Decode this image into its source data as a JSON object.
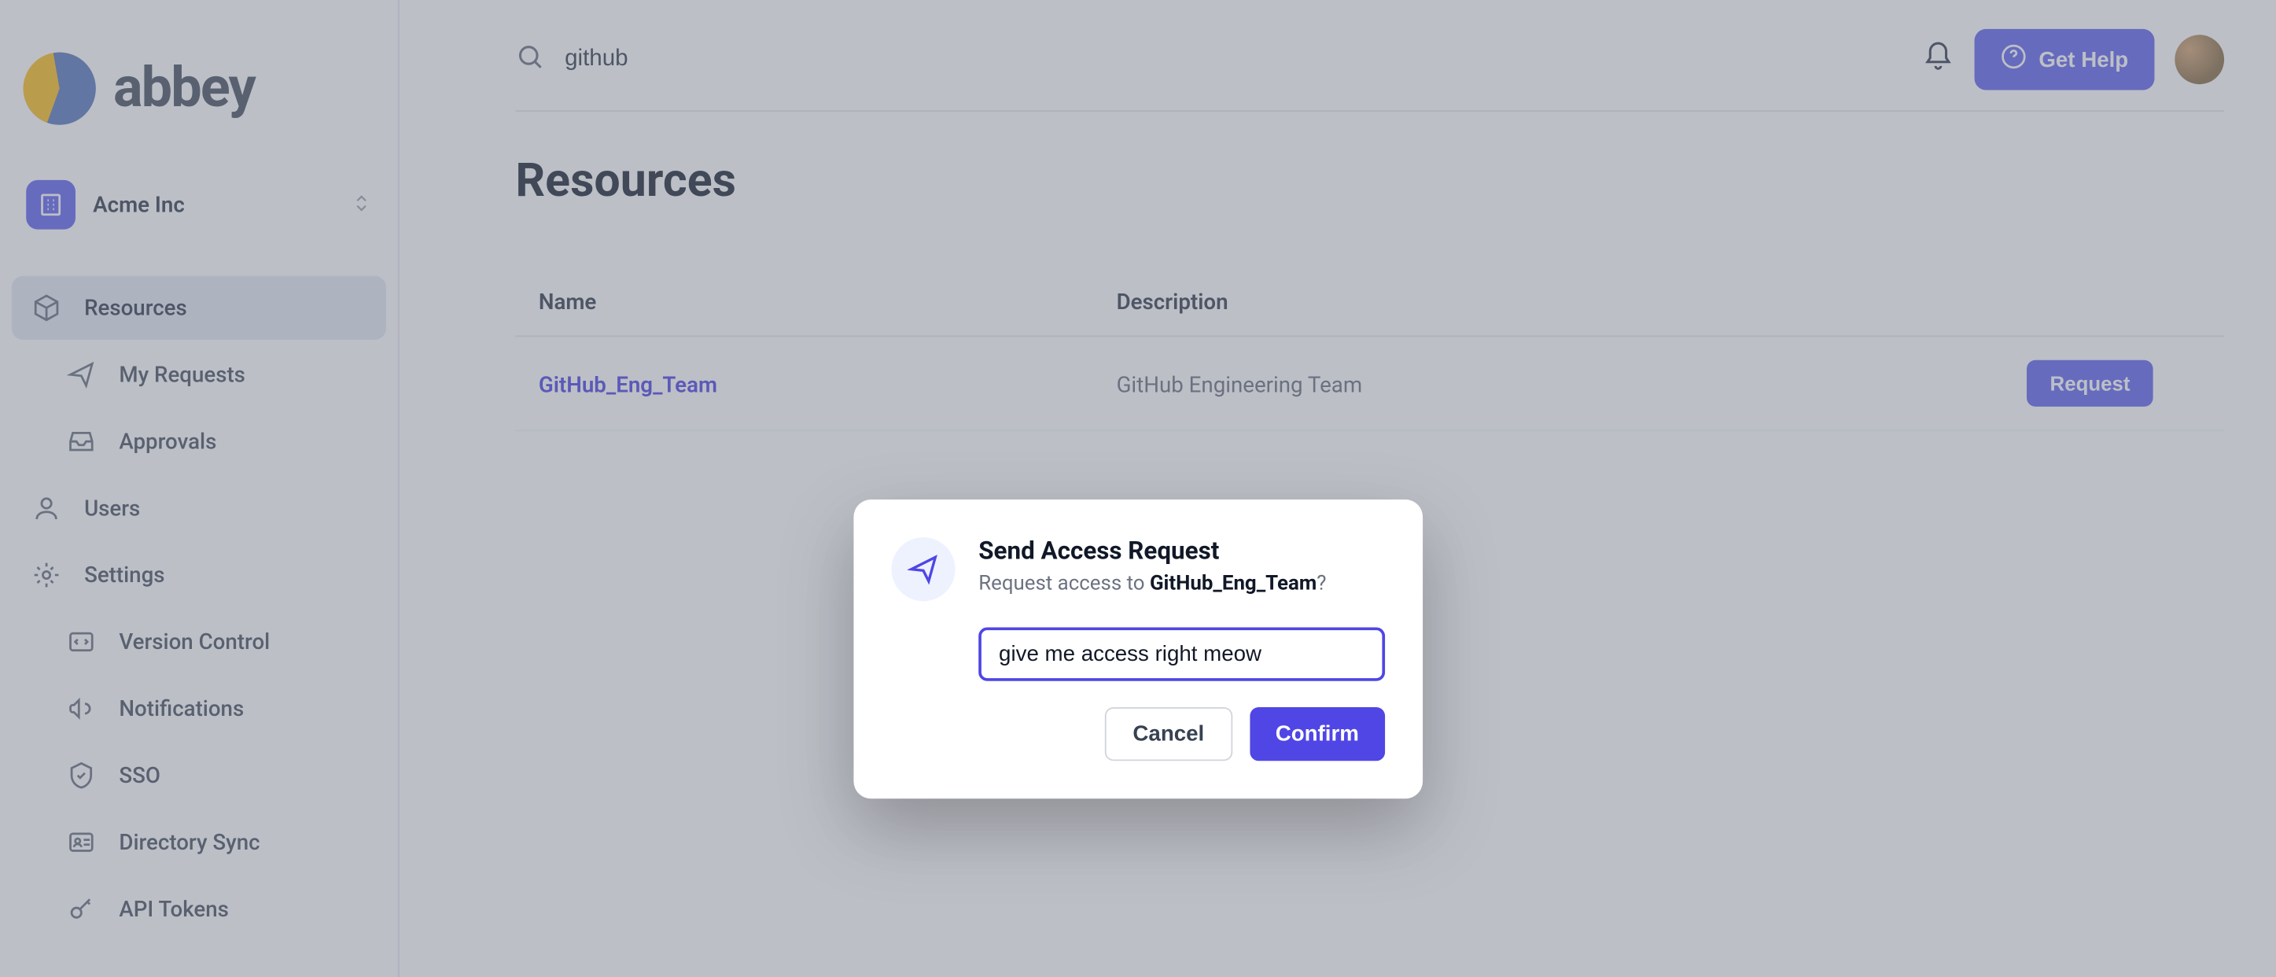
{
  "brand": "abbey",
  "org": {
    "name": "Acme Inc"
  },
  "sidebar": {
    "items": [
      {
        "label": "Resources",
        "icon": "cube"
      },
      {
        "label": "My Requests",
        "icon": "send"
      },
      {
        "label": "Approvals",
        "icon": "inbox"
      },
      {
        "label": "Users",
        "icon": "user"
      },
      {
        "label": "Settings",
        "icon": "gear"
      },
      {
        "label": "Version Control",
        "icon": "code"
      },
      {
        "label": "Notifications",
        "icon": "megaphone"
      },
      {
        "label": "SSO",
        "icon": "shield"
      },
      {
        "label": "Directory Sync",
        "icon": "id-card"
      },
      {
        "label": "API Tokens",
        "icon": "key"
      }
    ]
  },
  "search": {
    "value": "github"
  },
  "header": {
    "help": "Get Help"
  },
  "page": {
    "title": "Resources"
  },
  "table": {
    "columns": {
      "name": "Name",
      "description": "Description"
    },
    "rows": [
      {
        "name": "GitHub_Eng_Team",
        "description": "GitHub Engineering Team",
        "action": "Request"
      }
    ]
  },
  "modal": {
    "title": "Send Access Request",
    "subtitle_prefix": "Request access to ",
    "subtitle_target": "GitHub_Eng_Team",
    "subtitle_suffix": "?",
    "input_value": "give me access right meow",
    "cancel": "Cancel",
    "confirm": "Confirm"
  }
}
